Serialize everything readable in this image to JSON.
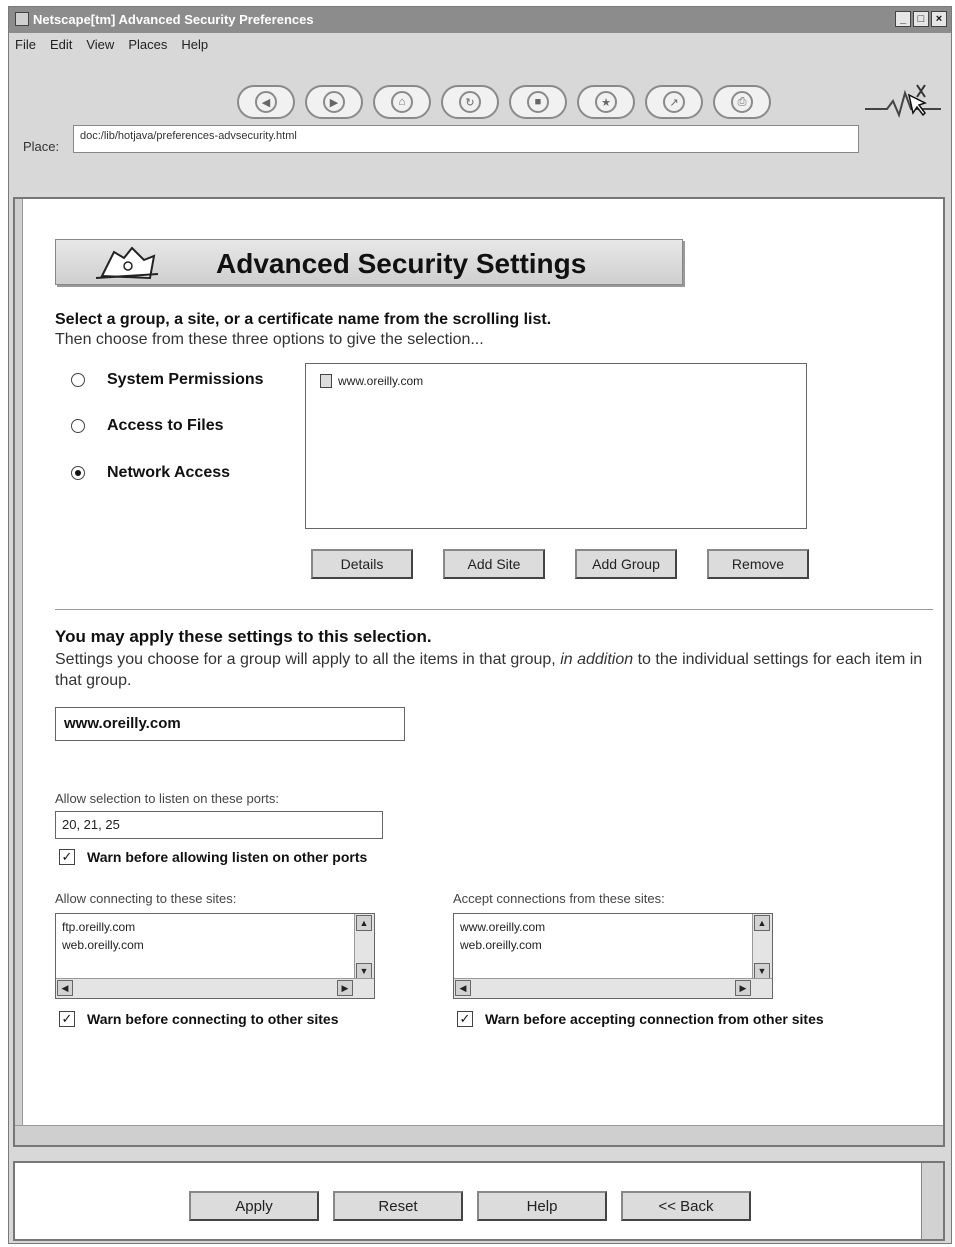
{
  "window": {
    "title": "Netscape[tm] Advanced Security Preferences",
    "controls": [
      "_",
      "□",
      "×"
    ]
  },
  "menu": [
    "File",
    "Edit",
    "View",
    "Places",
    "Help"
  ],
  "toolbar": {
    "nav_icons": [
      "back-icon",
      "forward-icon",
      "home-icon",
      "reload-icon",
      "stop-icon",
      "bookmark-icon",
      "open-icon",
      "print-icon"
    ]
  },
  "place": {
    "label": "Place:",
    "url": "doc:/lib/hotjava/preferences-advsecurity.html"
  },
  "banner": {
    "title": "Advanced Security Settings"
  },
  "instructions": {
    "line1": "Select a group, a site, or a certificate name from the scrolling list.",
    "line2": "Then choose from these three options to give the selection..."
  },
  "options": [
    {
      "label": "System Permissions",
      "selected": false
    },
    {
      "label": "Access to Files",
      "selected": false
    },
    {
      "label": "Network Access",
      "selected": true
    }
  ],
  "list": {
    "items": [
      "www.oreilly.com"
    ]
  },
  "list_buttons": [
    "Details",
    "Add Site",
    "Add Group",
    "Remove"
  ],
  "apply_section": {
    "heading": "You may apply these settings to this selection.",
    "desc_plain": "Settings you choose for a group will apply to all the items in that group,",
    "desc_italic": "in addition",
    "desc_tail": "to the individual settings for each item in that group.",
    "selection": "www.oreilly.com"
  },
  "ports": {
    "label": "Allow selection to listen on these ports:",
    "value": "20, 21, 25",
    "warn_label": "Warn before allowing listen on other ports",
    "warn_checked": true
  },
  "connect_to": {
    "label": "Allow connecting to these sites:",
    "sites": [
      "ftp.oreilly.com",
      "web.oreilly.com"
    ],
    "warn_label": "Warn before connecting to other sites",
    "warn_checked": true
  },
  "accept_from": {
    "label": "Accept connections from these sites:",
    "sites": [
      "www.oreilly.com",
      "web.oreilly.com"
    ],
    "warn_label": "Warn before accepting connection from other sites",
    "warn_checked": true
  },
  "bottom_buttons": [
    "Apply",
    "Reset",
    "Help",
    "<< Back"
  ]
}
